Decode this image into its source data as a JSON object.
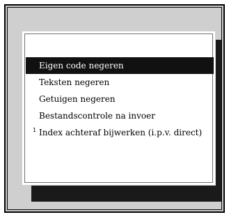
{
  "menu": {
    "items": [
      {
        "label": "Eigen code negeren",
        "marker": "",
        "selected": true
      },
      {
        "label": "Teksten negeren",
        "marker": "",
        "selected": false
      },
      {
        "label": "Getuigen negeren",
        "marker": "",
        "selected": false
      },
      {
        "label": "Bestandscontrole na invoer",
        "marker": "",
        "selected": false
      },
      {
        "label": "Index achteraf bijwerken (i.p.v. direct)",
        "marker": "1",
        "selected": false
      }
    ]
  },
  "colors": {
    "background": "#cfcfcf",
    "dialog": "#ffffff",
    "shadow": "#1a1a1a",
    "selection": "#111111"
  }
}
